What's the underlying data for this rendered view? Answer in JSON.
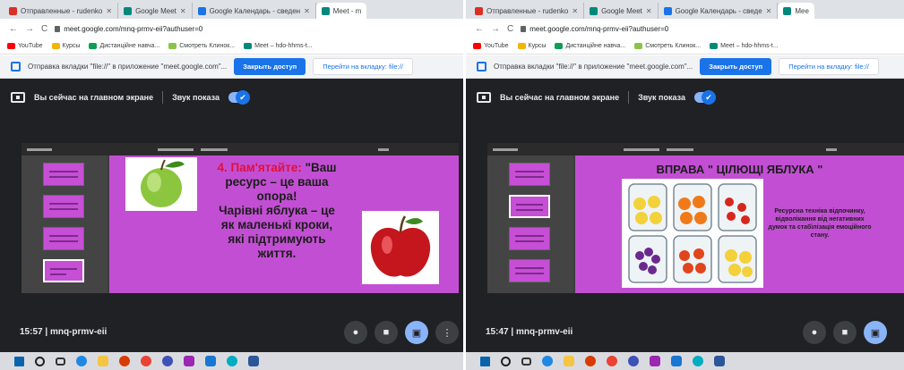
{
  "left": {
    "tabs": [
      {
        "label": "Отправленные - rudenko",
        "favicon_color": "#d93025",
        "active": false
      },
      {
        "label": "Google Meet",
        "favicon_color": "#00897b",
        "active": false
      },
      {
        "label": "Google Календарь - сведен",
        "favicon_color": "#1a73e8",
        "active": false
      },
      {
        "label": "Meet - m",
        "favicon_color": "#00897b",
        "active": true
      }
    ],
    "nav": {
      "back": "←",
      "forward": "→",
      "reload": "C"
    },
    "url": "meet.google.com/mnq-prmv-eii?authuser=0",
    "bookmarks": [
      {
        "label": "YouTube",
        "color": "#ff0000"
      },
      {
        "label": "Курсы",
        "color": "#f4b400"
      },
      {
        "label": "Дистанційне навча...",
        "color": "#0f9d58"
      },
      {
        "label": "Смотреть Клинок...",
        "color": "#8bc34a"
      },
      {
        "label": "Meet – hdo-hhms-t...",
        "color": "#00897b"
      }
    ],
    "infobar": {
      "text": "Отправка вкладки \"file://\" в приложение \"meet.google.com\"...",
      "primary_button": "Закрыть доступ",
      "secondary_button": "Перейти на вкладку: file://"
    },
    "presenting": {
      "label": "Вы сейчас на главном экране",
      "audio_label": "Звук показа",
      "toggle_check": "✔"
    },
    "slide": {
      "line1_num": "4.",
      "line1_red": "Пам'ятайте:",
      "line1_rest": " \"Ваш",
      "line2": "ресурс – це ваша",
      "line3": "опора!",
      "line4": "Чарівні яблука – це",
      "line5": "як маленькі кроки,",
      "line6": "які підтримують",
      "line7": "життя."
    },
    "meeting": {
      "time": "15:57",
      "sep": "|",
      "code": "mnq-prmv-eii"
    },
    "controls": {
      "mic": "●",
      "camera": "■",
      "present": "▣",
      "more": "⋮"
    }
  },
  "right": {
    "tabs": [
      {
        "label": "Отправленные - rudenko",
        "favicon_color": "#d93025",
        "active": false
      },
      {
        "label": "Google Meet",
        "favicon_color": "#00897b",
        "active": false
      },
      {
        "label": "Google Календарь - сведе",
        "favicon_color": "#1a73e8",
        "active": false
      },
      {
        "label": "Mee",
        "favicon_color": "#00897b",
        "active": true
      }
    ],
    "url": "meet.google.com/mnq-prmv-eii?authuser=0",
    "bookmarks": [
      {
        "label": "YouTube",
        "color": "#ff0000"
      },
      {
        "label": "Курсы",
        "color": "#f4b400"
      },
      {
        "label": "Дистанційне навча...",
        "color": "#0f9d58"
      },
      {
        "label": "Смотреть Клинок...",
        "color": "#8bc34a"
      },
      {
        "label": "Meet – hdo-hhms-t...",
        "color": "#00897b"
      }
    ],
    "infobar": {
      "text": "Отправка вкладки \"file://\" в приложение \"meet.google.com\"...",
      "primary_button": "Закрыть доступ",
      "secondary_button": "Перейти на вкладку: file://"
    },
    "presenting": {
      "label": "Вы сейчас на главном экране",
      "audio_label": "Звук показа",
      "toggle_check": "✔"
    },
    "slide": {
      "title": "ВПРАВА \" ЦІЛЮЩІ ЯБЛУКА \"",
      "description": "Ресурсна техніка відпочинку, відволікання від негативних думок та стабілізація емоційного стану."
    },
    "meeting": {
      "time": "15:47",
      "sep": "|",
      "code": "mnq-prmv-eii"
    }
  },
  "colors": {
    "slide_bg": "#c24fd3",
    "meet_bg": "#202124",
    "accent": "#1a73e8",
    "highlight_red": "#e0103c"
  }
}
